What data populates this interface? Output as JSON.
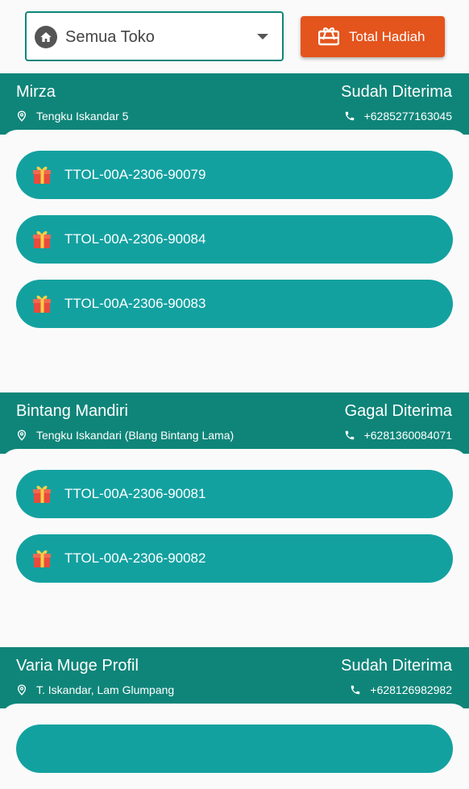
{
  "filter": {
    "store_label": "Semua Toko",
    "total_button_label": "Total Hadiah"
  },
  "colors": {
    "header_teal": "#0f8579",
    "voucher_teal": "#13a1a0",
    "accent_orange": "#e4541d"
  },
  "sections": [
    {
      "name": "Mirza",
      "status": "Sudah Diterima",
      "address": "Tengku Iskandar 5",
      "phone": "+6285277163045",
      "vouchers": [
        "TTOL-00A-2306-90079",
        "TTOL-00A-2306-90084",
        "TTOL-00A-2306-90083"
      ]
    },
    {
      "name": "Bintang Mandiri",
      "status": "Gagal Diterima",
      "address": "Tengku Iskandari (Blang Bintang Lama)",
      "phone": "+6281360084071",
      "vouchers": [
        "TTOL-00A-2306-90081",
        "TTOL-00A-2306-90082"
      ]
    },
    {
      "name": "Varia Muge Profil",
      "status": "Sudah Diterima",
      "address": "T. Iskandar, Lam Glumpang",
      "phone": "+628126982982",
      "vouchers": [
        ""
      ]
    }
  ]
}
